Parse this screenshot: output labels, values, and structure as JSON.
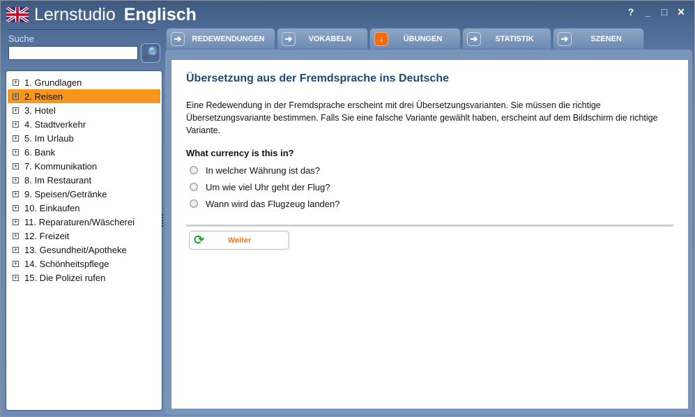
{
  "app": {
    "title_light": "Lernstudio",
    "title_bold": "Englisch",
    "controls": [
      "?",
      "_",
      "□",
      "✕"
    ]
  },
  "search": {
    "label": "Suche",
    "value": "",
    "placeholder": ""
  },
  "tree": {
    "items": [
      "1. Grundlagen",
      "2. Reisen",
      "3. Hotel",
      "4. Stadtverkehr",
      "5. Im Urlaub",
      "6. Bank",
      "7. Kommunikation",
      "8. Im Restaurant",
      "9. Speisen/Getränke",
      "10. Einkaufen",
      "11. Reparaturen/Wäscherei",
      "12. Freizeit",
      "13. Gesundheit/Apotheke",
      "14. Schönheitspflege",
      "15. Die Polizei rufen"
    ],
    "selected": 1
  },
  "tabs": [
    {
      "label": "REDEWENDUNGEN"
    },
    {
      "label": "VOKABELN"
    },
    {
      "label": "ÜBUNGEN",
      "active": true
    },
    {
      "label": "STATISTIK"
    },
    {
      "label": "SZENEN"
    }
  ],
  "exercise": {
    "title": "Übersetzung aus der Fremdsprache ins Deutsche",
    "description": "Eine Redewendung in der Fremdsprache erscheint mit drei Übersetzungsvarianten. Sie müssen die richtige Übersetzungsvariante bestimmen. Falls Sie eine falsche Variante gewählt haben, erscheint auf dem Bildschirm die richtige Variante.",
    "question": "What currency is this in?",
    "options": [
      "In welcher Währung ist das?",
      "Um wie viel Uhr geht der Flug?",
      "Wann wird das Flugzeug landen?"
    ],
    "next_label": "Weiter"
  }
}
